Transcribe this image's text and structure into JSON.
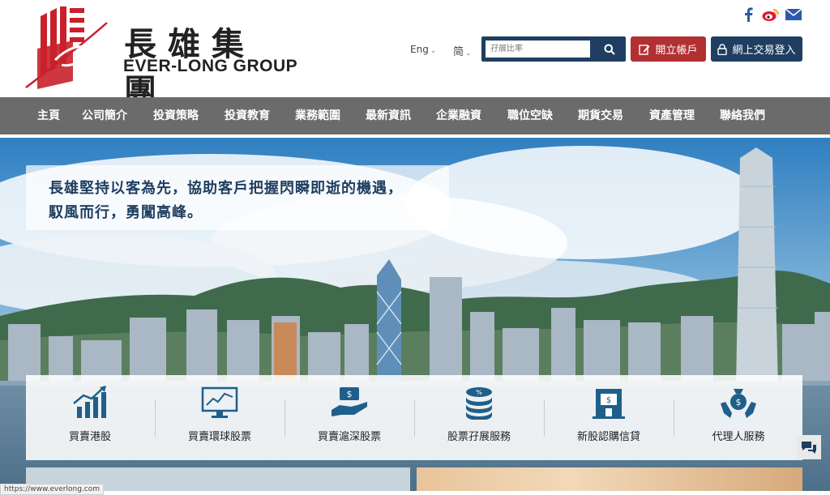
{
  "brand": {
    "name_cn": "長雄集團",
    "name_en": "EVER-LONG GROUP",
    "accent": "#c8212a",
    "primary": "#1f3e61"
  },
  "header": {
    "social_icons": [
      "facebook-icon",
      "weibo-icon",
      "mail-icon"
    ],
    "lang_en": "Eng",
    "lang_cn": "简",
    "search_placeholder": "孖展比率",
    "open_account": "開立帳戶",
    "online_login": "網上交易登入"
  },
  "nav": {
    "items": [
      "主頁",
      "公司簡介",
      "投資策略",
      "投資教育",
      "業務範圍",
      "最新資訊",
      "企業融資",
      "職位空缺",
      "期貨交易",
      "資產管理",
      "聯絡我們"
    ]
  },
  "hero": {
    "line1": "長雄堅持以客為先，協助客戶把握閃瞬即逝的機遇，",
    "line2": "馭風而行，勇闖高峰。"
  },
  "services": [
    {
      "label": "買賣港股",
      "icon": "rising-chart-icon"
    },
    {
      "label": "買賣環球股票",
      "icon": "monitor-chart-icon"
    },
    {
      "label": "買賣滬深股票",
      "icon": "hand-cash-icon"
    },
    {
      "label": "股票孖展服務",
      "icon": "coin-stack-icon"
    },
    {
      "label": "新股認購信貸",
      "icon": "bank-building-icon"
    },
    {
      "label": "代理人服務",
      "icon": "money-bag-hands-icon"
    }
  ],
  "status_bar": {
    "url": "https://www.everlong.com"
  }
}
